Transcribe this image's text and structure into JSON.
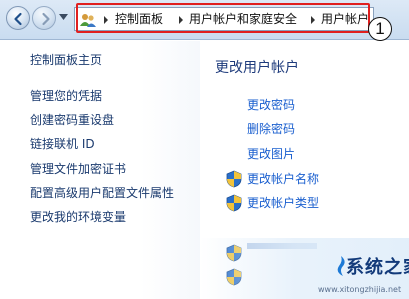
{
  "address_bar": {
    "crumbs": [
      "控制面板",
      "用户帐户和家庭安全",
      "用户帐户"
    ]
  },
  "callout": "1",
  "sidebar": {
    "items": [
      "控制面板主页",
      "管理您的凭据",
      "创建密码重设盘",
      "链接联机 ID",
      "管理文件加密证书",
      "配置高级用户配置文件属性",
      "更改我的环境变量"
    ]
  },
  "main": {
    "title": "更改用户帐户",
    "links": [
      {
        "label": "更改密码",
        "icon": null
      },
      {
        "label": "删除密码",
        "icon": null
      },
      {
        "label": "更改图片",
        "icon": null
      },
      {
        "label": "更改帐户名称",
        "icon": "shield-icon"
      },
      {
        "label": "更改帐户类型",
        "icon": "shield-icon"
      }
    ],
    "partial_links_icons": [
      "shield-icon",
      "shield-icon"
    ]
  },
  "watermark": {
    "text": "系统之家",
    "url": "www.xitongzhijia.net"
  },
  "colors": {
    "link": "#1a5fcf",
    "nav_text": "#1a3a6e",
    "title": "#1e3b7c",
    "highlight": "#e02020",
    "shield_blue": "#2a6fc9",
    "shield_yellow": "#f2c33a"
  }
}
